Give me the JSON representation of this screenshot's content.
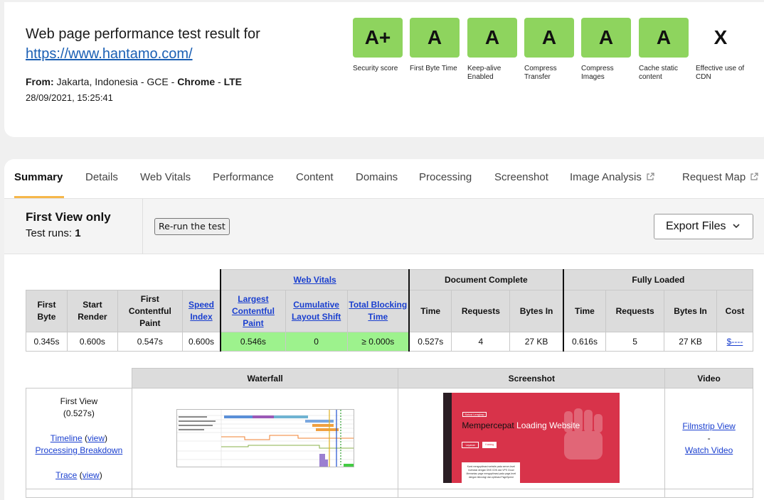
{
  "header": {
    "title": "Web page performance test result for",
    "url": "https://www.hantamo.com/",
    "from_label": "From:",
    "from_location": " Jakarta, Indonesia - GCE - ",
    "browser": "Chrome",
    "sep": " - ",
    "connection": "LTE",
    "date": "28/09/2021, 15:25:41"
  },
  "grades": [
    {
      "grade": "A+",
      "label": "Security score",
      "color": "#8ed45e"
    },
    {
      "grade": "A",
      "label": "First Byte Time",
      "color": "#8ed45e"
    },
    {
      "grade": "A",
      "label": "Keep-alive Enabled",
      "color": "#8ed45e"
    },
    {
      "grade": "A",
      "label": "Compress Transfer",
      "color": "#8ed45e"
    },
    {
      "grade": "A",
      "label": "Compress Images",
      "color": "#8ed45e"
    },
    {
      "grade": "A",
      "label": "Cache static content",
      "color": "#8ed45e"
    },
    {
      "grade": "X",
      "label": "Effective use of CDN",
      "color": null
    }
  ],
  "tabs": [
    {
      "label": "Summary",
      "active": true
    },
    {
      "label": "Details"
    },
    {
      "label": "Web Vitals"
    },
    {
      "label": "Performance"
    },
    {
      "label": "Content"
    },
    {
      "label": "Domains"
    },
    {
      "label": "Processing"
    },
    {
      "label": "Screenshot"
    },
    {
      "label": "Image Analysis",
      "external": true
    },
    {
      "label": "Request Map",
      "external": true
    }
  ],
  "summary": {
    "view_title": "First View only",
    "runs_label": "Test runs: ",
    "runs_value": "1",
    "rerun_label": "Re-run the test",
    "export_label": "Export Files"
  },
  "metrics": {
    "groups": {
      "web_vitals": "Web Vitals",
      "document_complete": "Document Complete",
      "fully_loaded": "Fully Loaded"
    },
    "columns": {
      "first_byte": "First Byte",
      "start_render": "Start Render",
      "fcp": "First Contentful Paint",
      "speed_index": "Speed Index",
      "lcp": "Largest Contentful Paint",
      "cls": "Cumulative Layout Shift",
      "tbt": "Total Blocking Time",
      "dc_time": "Time",
      "dc_requests": "Requests",
      "dc_bytes": "Bytes In",
      "fl_time": "Time",
      "fl_requests": "Requests",
      "fl_bytes": "Bytes In",
      "cost": "Cost"
    },
    "values": {
      "first_byte": "0.345s",
      "start_render": "0.600s",
      "fcp": "0.547s",
      "speed_index": "0.600s",
      "lcp": "0.546s",
      "cls": "0",
      "tbt": "≥ 0.000s",
      "dc_time": "0.527s",
      "dc_requests": "4",
      "dc_bytes": "27 KB",
      "fl_time": "0.616s",
      "fl_requests": "5",
      "fl_bytes": "27 KB",
      "cost": "$----"
    },
    "good_color": "#9df28d"
  },
  "media": {
    "headers": {
      "waterfall": "Waterfall",
      "screenshot": "Screenshot",
      "video": "Video"
    },
    "first_view": {
      "label": "First View",
      "time": "(0.527s)",
      "timeline": "Timeline",
      "view": "view",
      "processing": "Processing Breakdown",
      "trace": "Trace"
    },
    "video": {
      "filmstrip": "Filmstrip View",
      "dash": "-",
      "watch": "Watch Video"
    },
    "screenshot_thumb": {
      "badge": "Solusi Lengkap",
      "heading_bold": "Mempercepat",
      "heading_rest": " Loading Website",
      "btn1": "Layanan",
      "btn2": "Katalog",
      "card_line1": "Kami mengoptimasi website pada server-level",
      "card_line2": "Investasi dengan DNS CDN dan VPS Cloud",
      "card_line3": "Memantau page mengoptimasi pada page-level",
      "card_line4": "dengan teknologi dan optimasi PageSpeed"
    }
  }
}
